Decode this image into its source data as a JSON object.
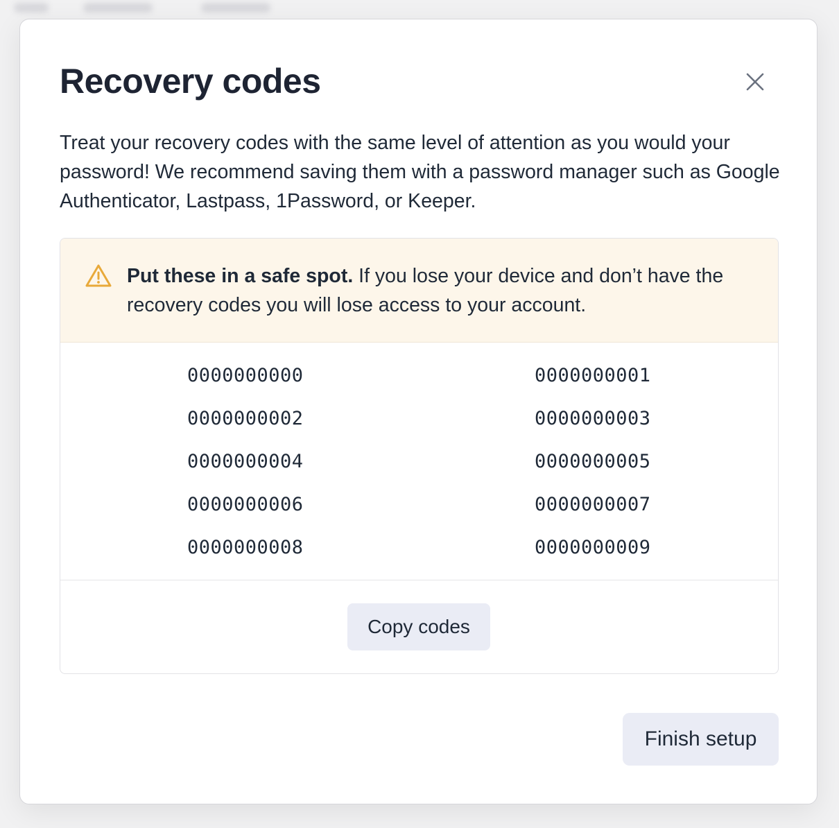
{
  "modal": {
    "title": "Recovery codes",
    "close_icon": "close-icon",
    "intro": "Treat your recovery codes with the same level of attention as you would your password! We recommend saving them with a password manager such as Google Authenticator, Lastpass, 1Password, or Keeper.",
    "alert": {
      "icon": "warning-icon",
      "color": "#e8a93a",
      "bold": "Put these in a safe spot.",
      "text": " If you lose your device and don’t have the recovery codes you will lose access to your account."
    },
    "codes": [
      "0000000000",
      "0000000001",
      "0000000002",
      "0000000003",
      "0000000004",
      "0000000005",
      "0000000006",
      "0000000007",
      "0000000008",
      "0000000009"
    ],
    "copy_label": "Copy codes",
    "finish_label": "Finish setup"
  }
}
